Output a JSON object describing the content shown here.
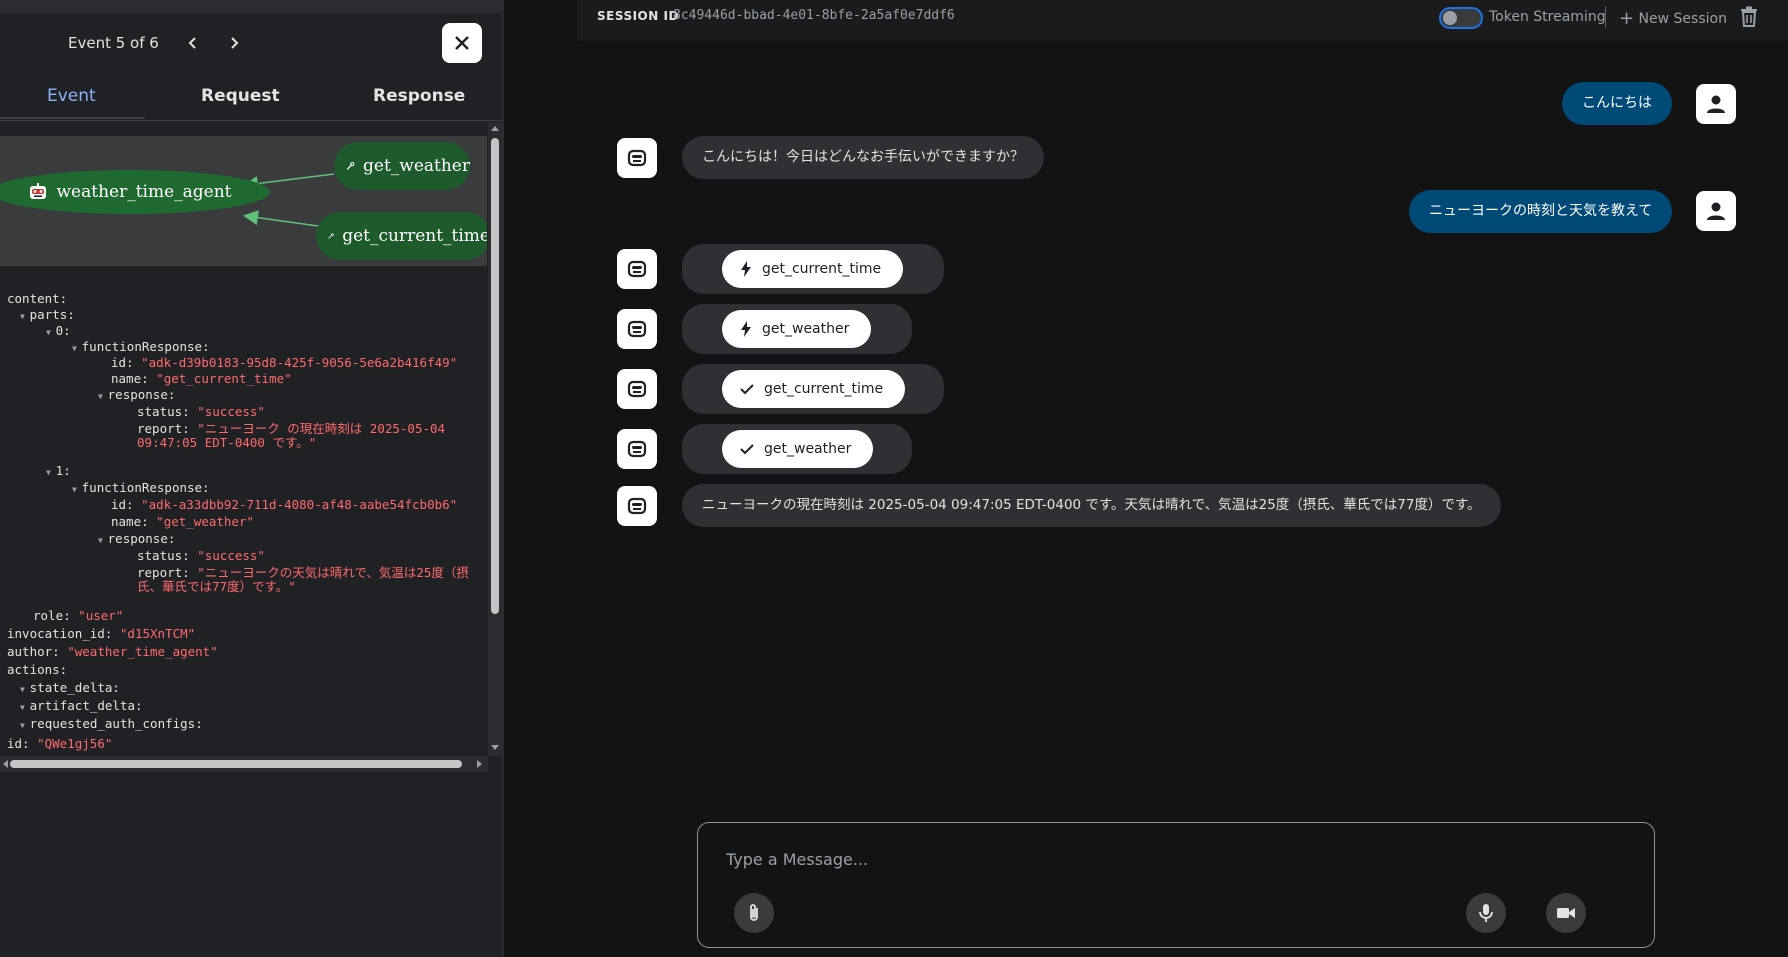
{
  "event_panel": {
    "counter": "Event 5 of 6",
    "tabs": [
      "Event",
      "Request",
      "Response"
    ],
    "graph": {
      "agent": "weather_time_agent",
      "tools": [
        "get_weather",
        "get_current_time"
      ]
    },
    "json_lines": [
      {
        "k": "content:",
        "v": ""
      },
      {
        "k": "parts:",
        "v": ""
      },
      {
        "k": "0:",
        "v": ""
      },
      {
        "k": "functionResponse:",
        "v": ""
      },
      {
        "k": "id:",
        "v": "\"adk-d39b0183-95d8-425f-9056-5e6a2b416f49\""
      },
      {
        "k": "name:",
        "v": "\"get_current_time\""
      },
      {
        "k": "response:",
        "v": ""
      },
      {
        "k": "status:",
        "v": "\"success\""
      },
      {
        "k": "report:",
        "v": "\"ニューヨーク の現在時刻は 2025-05-04"
      },
      {
        "k": "",
        "v": "09:47:05 EDT-0400 です。\""
      },
      {
        "k": "1:",
        "v": ""
      },
      {
        "k": "functionResponse:",
        "v": ""
      },
      {
        "k": "id:",
        "v": "\"adk-a33dbb92-711d-4080-af48-aabe54fcb0b6\""
      },
      {
        "k": "name:",
        "v": "\"get_weather\""
      },
      {
        "k": "response:",
        "v": ""
      },
      {
        "k": "status:",
        "v": "\"success\""
      },
      {
        "k": "report:",
        "v": "\"ニューヨークの天気は晴れで、気温は25度（摂"
      },
      {
        "k": "",
        "v": "氏、華氏では77度）です。\""
      },
      {
        "k": "role:",
        "v": "\"user\""
      },
      {
        "k": "invocation_id:",
        "v": "\"d15XnTCM\""
      },
      {
        "k": "author:",
        "v": "\"weather_time_agent\""
      },
      {
        "k": "actions:",
        "v": ""
      },
      {
        "k": "state_delta:",
        "v": ""
      },
      {
        "k": "artifact_delta:",
        "v": ""
      },
      {
        "k": "requested_auth_configs:",
        "v": ""
      },
      {
        "k": "id:",
        "v": "\"QWe1gj56\""
      }
    ]
  },
  "header": {
    "session_label": "SESSION ID",
    "session_id": "8c49446d-bbad-4e01-8bfe-2a5af0e7ddf6",
    "token_streaming": "Token Streaming",
    "new_session": "New Session"
  },
  "messages": {
    "user1": "こんにちは",
    "bot1": "こんにちは！今日はどんなお手伝いができますか？",
    "user2": "ニューヨークの時刻と天気を教えて",
    "fn1": "get_current_time",
    "fn2": "get_weather",
    "fn3": "get_current_time",
    "fn4": "get_weather",
    "bot_final": "ニューヨークの現在時刻は 2025-05-04 09:47:05 EDT-0400 です。天気は晴れで、気温は25度（摂氏、華氏では77度）です。"
  },
  "input": {
    "placeholder": "Type a Message..."
  },
  "colors": {
    "user_bubble": "#004a77",
    "bot_bubble": "#2f3033",
    "active_tab": "#8ab4f8",
    "graph_node": "#1e6a30",
    "json_string": "#ff6b6b"
  }
}
